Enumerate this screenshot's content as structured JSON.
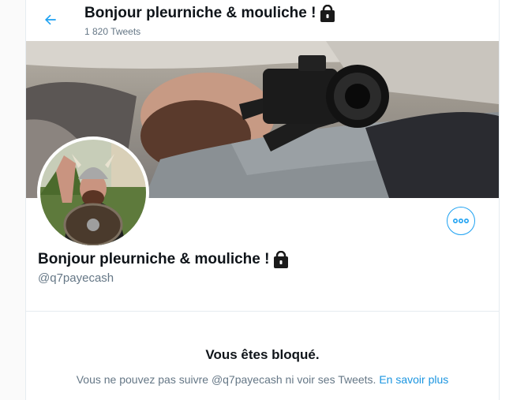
{
  "header": {
    "title": "Bonjour pleurniche & mouliche !",
    "tweet_count": "1 820 Tweets"
  },
  "profile": {
    "name": "Bonjour pleurniche & mouliche !",
    "handle": "@q7payecash"
  },
  "blocked": {
    "title": "Vous êtes bloqué.",
    "message": "Vous ne pouvez pas suivre @q7payecash ni voir ses Tweets.",
    "learn_more": "En savoir plus"
  },
  "icons": {
    "back": "back-arrow-icon",
    "lock": "lock-icon",
    "more": "more-options-icon"
  },
  "colors": {
    "accent": "#1da1f2",
    "link": "#1b95e0",
    "secondary_text": "#657786"
  }
}
